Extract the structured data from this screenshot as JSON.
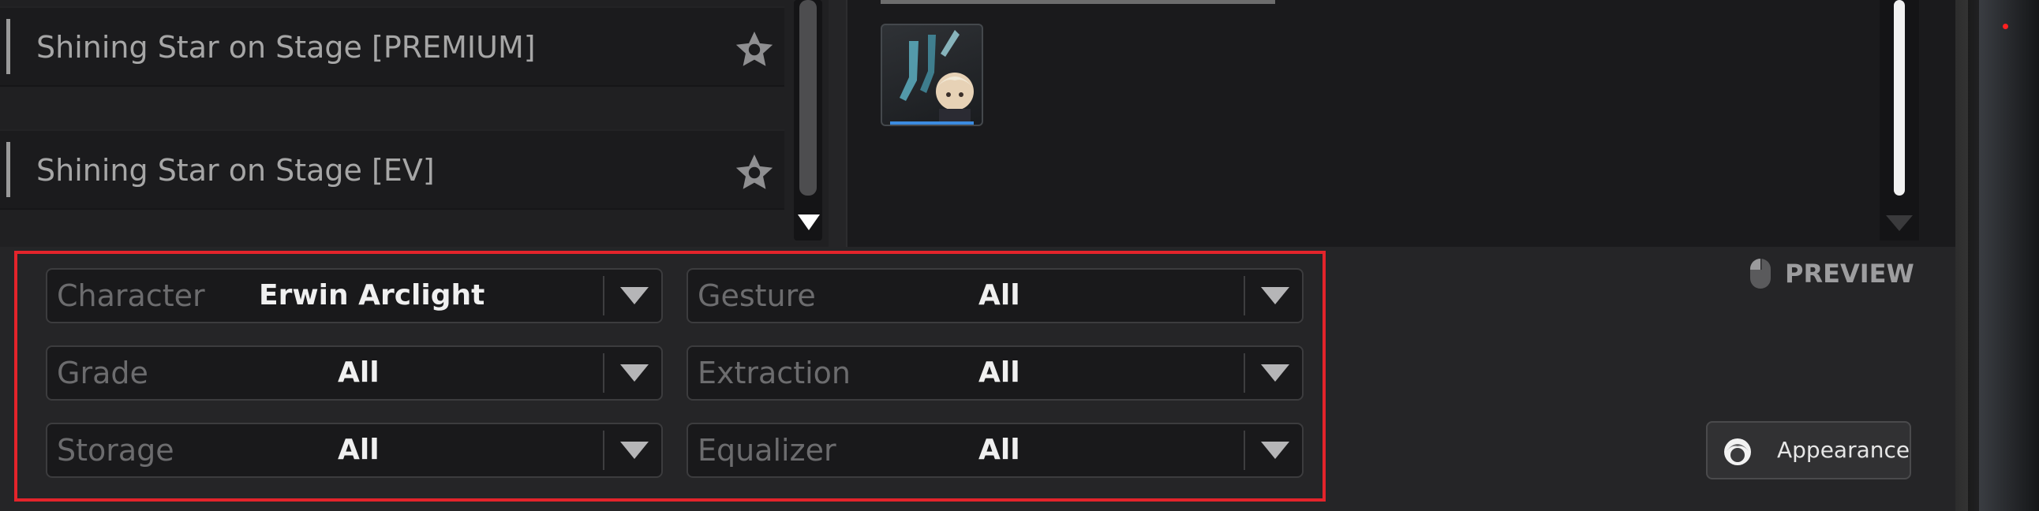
{
  "list": {
    "items": [
      {
        "label": "Shining Star on Stage [PREMIUM]"
      },
      {
        "label": "Shining Star on Stage [EV]"
      }
    ]
  },
  "preview": {
    "label": "PREVIEW"
  },
  "filters": {
    "character": {
      "label": "Character",
      "value": "Erwin Arclight"
    },
    "gesture": {
      "label": "Gesture",
      "value": "All"
    },
    "grade": {
      "label": "Grade",
      "value": "All"
    },
    "extraction": {
      "label": "Extraction",
      "value": "All"
    },
    "storage": {
      "label": "Storage",
      "value": "All"
    },
    "equalizer": {
      "label": "Equalizer",
      "value": "All"
    }
  },
  "appearance_button": {
    "label": "Appearance"
  },
  "icons": {
    "favorite": "star-icon",
    "dropdown": "chevron-down-icon",
    "mouse": "mouse-icon",
    "appearance": "hair-icon"
  },
  "colors": {
    "highlight_frame": "#e3242b",
    "accent_blue": "#3b8be0"
  }
}
